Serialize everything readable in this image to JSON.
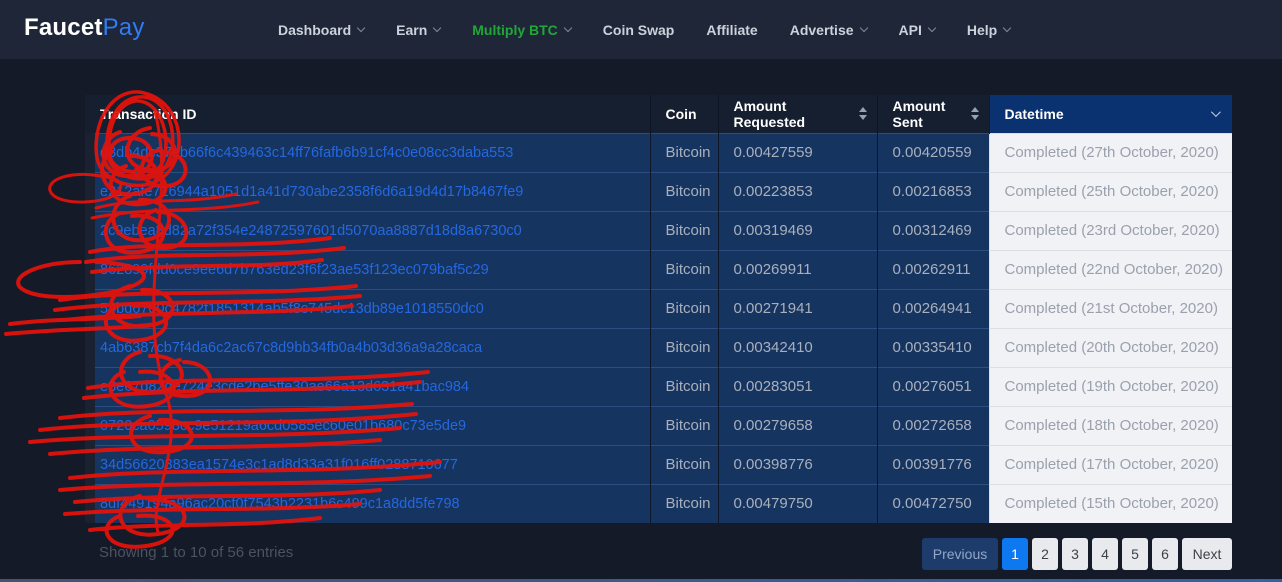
{
  "brand": {
    "name_primary": "Faucet",
    "name_secondary": "Pay"
  },
  "nav": {
    "items": [
      {
        "label": "Dashboard",
        "has_dropdown": true,
        "active": false
      },
      {
        "label": "Earn",
        "has_dropdown": true,
        "active": false
      },
      {
        "label": "Multiply BTC",
        "has_dropdown": true,
        "active": true
      },
      {
        "label": "Coin Swap",
        "has_dropdown": false,
        "active": false
      },
      {
        "label": "Affiliate",
        "has_dropdown": false,
        "active": false
      },
      {
        "label": "Advertise",
        "has_dropdown": true,
        "active": false
      },
      {
        "label": "API",
        "has_dropdown": true,
        "active": false
      },
      {
        "label": "Help",
        "has_dropdown": true,
        "active": false
      }
    ]
  },
  "table": {
    "columns": [
      {
        "label": "Transaction ID",
        "icon": "none"
      },
      {
        "label": "Coin",
        "icon": "none"
      },
      {
        "label": "Amount Requested",
        "icon": "sort-updown-icon"
      },
      {
        "label": "Amount Sent",
        "icon": "sort-updown-icon"
      },
      {
        "label": "Datetime",
        "icon": "chevron-down-icon",
        "sorted": "desc"
      }
    ],
    "rows": [
      {
        "txid": "d3db4dc37eb66f6c439463c14ff76fafb6b91cf4c0e08cc3daba553",
        "coin": "Bitcoin",
        "requested": "0.00427559",
        "sent": "0.00420559",
        "datetime": "Completed (27th October, 2020)"
      },
      {
        "txid": "e212afe716944a1051d1a41d730abe2358f6d6a19d4d17b8467fe9",
        "coin": "Bitcoin",
        "requested": "0.00223853",
        "sent": "0.00216853",
        "datetime": "Completed (25th October, 2020)"
      },
      {
        "txid": "2c9ebea8d82a72f354e24872597601d5070aa8887d18d8a6730c0",
        "coin": "Bitcoin",
        "requested": "0.00319469",
        "sent": "0.00312469",
        "datetime": "Completed (23rd October, 2020)"
      },
      {
        "txid": "862899fdd0ce9ee6d7b763ed23f6f23ae53f123ec079baf5c29",
        "coin": "Bitcoin",
        "requested": "0.00269911",
        "sent": "0.00262911",
        "datetime": "Completed (22nd October, 2020)"
      },
      {
        "txid": "54bd6700c4782f1851314ab5f8c745dc13db89e1018550dc0",
        "coin": "Bitcoin",
        "requested": "0.00271941",
        "sent": "0.00264941",
        "datetime": "Completed (21st October, 2020)"
      },
      {
        "txid": "4ab6387cb7f4da6c2ac67c8d9bb34fb0a4b03d36a9a28caca",
        "coin": "Bitcoin",
        "requested": "0.00342410",
        "sent": "0.00335410",
        "datetime": "Completed (20th October, 2020)"
      },
      {
        "txid": "e3e67d82de724e3cde2be5ffe30ae66a13d631a41bac984",
        "coin": "Bitcoin",
        "requested": "0.00283051",
        "sent": "0.00276051",
        "datetime": "Completed (19th October, 2020)"
      },
      {
        "txid": "0720ca0598cc9e51219a6cd0585ec60e01b680c73e5de9",
        "coin": "Bitcoin",
        "requested": "0.00279658",
        "sent": "0.00272658",
        "datetime": "Completed (18th October, 2020)"
      },
      {
        "txid": "34d56620383ea1574e3c1ad8d33a31f016ff0288710677",
        "coin": "Bitcoin",
        "requested": "0.00398776",
        "sent": "0.00391776",
        "datetime": "Completed (17th October, 2020)"
      },
      {
        "txid": "8df449194a96ac20cf0f7543b2231b6c499c1a8dd5fe798",
        "coin": "Bitcoin",
        "requested": "0.00479750",
        "sent": "0.00472750",
        "datetime": "Completed (15th October, 2020)"
      }
    ]
  },
  "footer": {
    "showing_text": "Showing 1 to 10 of 56 entries"
  },
  "pagination": {
    "previous_label": "Previous",
    "pages": [
      "1",
      "2",
      "3",
      "4",
      "5",
      "6"
    ],
    "active_page": "1",
    "next_label": "Next"
  },
  "colors": {
    "page_bg": "#141a28",
    "navbar_bg": "#1e2637",
    "brand_blue": "#2e7cf6",
    "active_nav_green": "#23a638",
    "row_bg": "#163460",
    "link_blue": "#2468e0",
    "datetime_header_bg": "#0a3170",
    "datetime_cell_bg": "#f1f2f6",
    "active_page_blue": "#0d78f0",
    "scribble_red": "#e8120a"
  }
}
